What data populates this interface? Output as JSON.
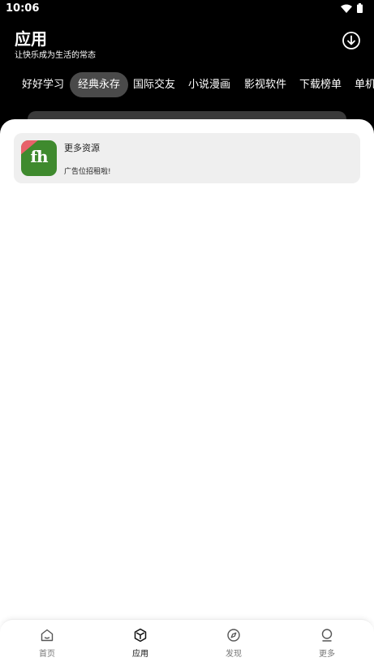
{
  "status_bar": {
    "time": "10:06"
  },
  "header": {
    "title": "应用",
    "subtitle": "让快乐成为生活的常态",
    "download_icon": "download-circle-icon"
  },
  "tabs": [
    {
      "label": "好好学习",
      "active": false
    },
    {
      "label": "经典永存",
      "active": true
    },
    {
      "label": "国际交友",
      "active": false
    },
    {
      "label": "小说漫画",
      "active": false
    },
    {
      "label": "影视软件",
      "active": false
    },
    {
      "label": "下载榜单",
      "active": false
    },
    {
      "label": "单机",
      "active": false
    }
  ],
  "card": {
    "icon_text": "fh",
    "title": "更多资源",
    "description": "广告位招租啦!"
  },
  "bottom_nav": [
    {
      "label": "首页",
      "icon": "home-icon",
      "active": false
    },
    {
      "label": "应用",
      "icon": "cube-icon",
      "active": true
    },
    {
      "label": "发现",
      "icon": "compass-icon",
      "active": false
    },
    {
      "label": "更多",
      "icon": "user-icon",
      "active": false
    }
  ],
  "colors": {
    "background": "#000000",
    "sheet": "#ffffff",
    "card": "#efefef",
    "active_tab": "#4a4a4a",
    "app_icon_green": "#3f8a2e",
    "app_icon_ribbon": "#e8616a"
  }
}
